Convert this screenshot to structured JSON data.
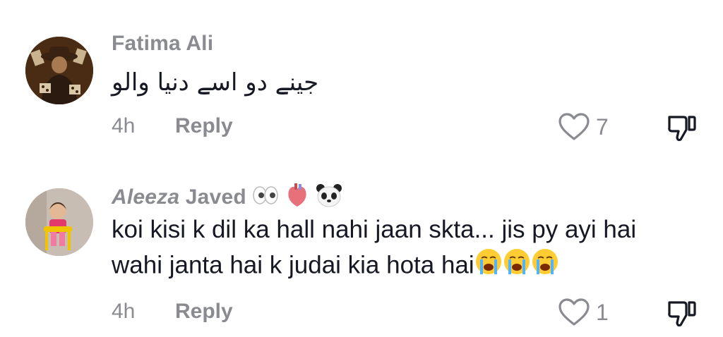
{
  "comments": [
    {
      "username": "Fatima Ali",
      "text": "جینے دو اسے دنیا والو",
      "time": "4h",
      "reply_label": "Reply",
      "likes": "7"
    },
    {
      "username_first": "Aleeza",
      "username_rest": " Javed",
      "username_emojis": [
        "eyes-emoji",
        "anatomical-heart-emoji",
        "panda-emoji"
      ],
      "text_line1": "koi kisi k dil ka hall nahi jaan skta... jis py ayi hai",
      "text_line2": "wahi janta hai k judai kia hota hai",
      "text_emojis": [
        "loudly-crying-face-emoji",
        "loudly-crying-face-emoji",
        "loudly-crying-face-emoji"
      ],
      "time": "4h",
      "reply_label": "Reply",
      "likes": "1"
    }
  ],
  "colors": {
    "text": "#161823",
    "muted": "#8a8b91"
  }
}
